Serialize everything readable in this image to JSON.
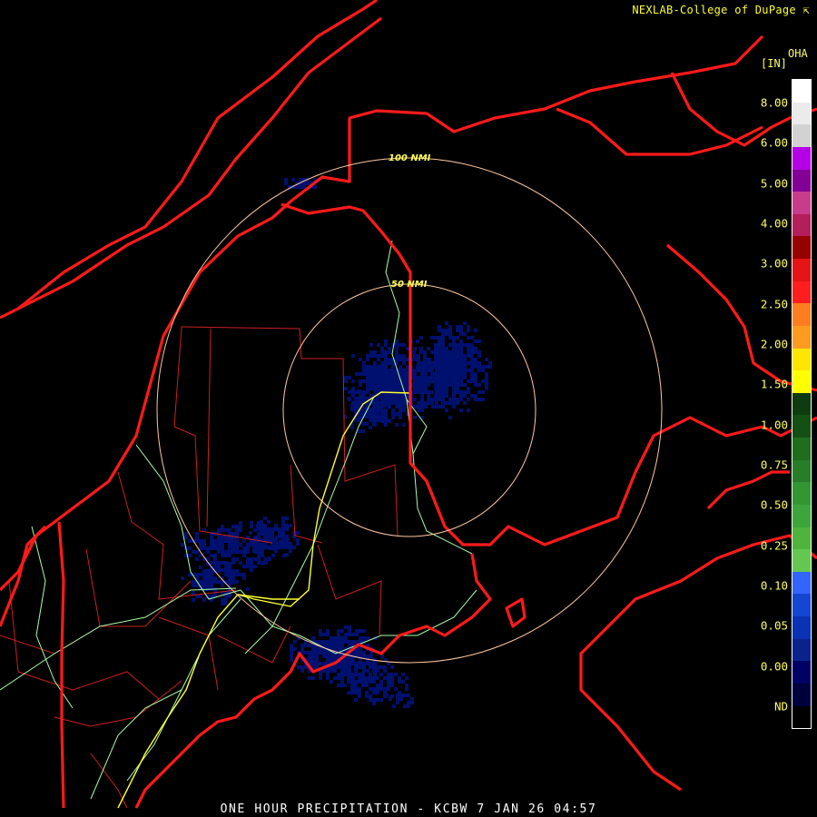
{
  "header": {
    "credit": "NEXLAB-College of DuPage",
    "credit_icon": "external-link-icon"
  },
  "legend": {
    "units": "[IN]",
    "product_code": "OHA",
    "labels": [
      "8.00",
      "6.00",
      "5.00",
      "4.00",
      "3.00",
      "2.50",
      "2.00",
      "1.50",
      "1.00",
      "0.75",
      "0.50",
      "0.25",
      "0.10",
      "0.05",
      "0.00",
      "ND"
    ],
    "colors": [
      "#ffffff",
      "#ebebeb",
      "#d2d2d2",
      "#b400e6",
      "#820096",
      "#c83c8c",
      "#b41e5a",
      "#960000",
      "#e61414",
      "#ff1e1e",
      "#ff7d1e",
      "#ff9b1e",
      "#ffe600",
      "#ffff00",
      "#0f3c0f",
      "#145014",
      "#1e6e1e",
      "#287d28",
      "#329632",
      "#3ca53c",
      "#50b43c",
      "#64c850",
      "#3264ff",
      "#1446d2",
      "#0a32b4",
      "#0a238c",
      "#000064",
      "#00003c",
      "#000000"
    ]
  },
  "map": {
    "range_rings": [
      "100 NMI",
      "50 NMI"
    ],
    "border_color": "#ff1a1a",
    "county_color": "#cc1f1f",
    "road_color": "#aaffaa",
    "interstate_color": "#ffff33",
    "ring_color": "#ffc8a0",
    "echo_color": "#00106e"
  },
  "footer": {
    "title": "ONE HOUR PRECIPITATION - KCBW 7 JAN 26 04:57"
  }
}
